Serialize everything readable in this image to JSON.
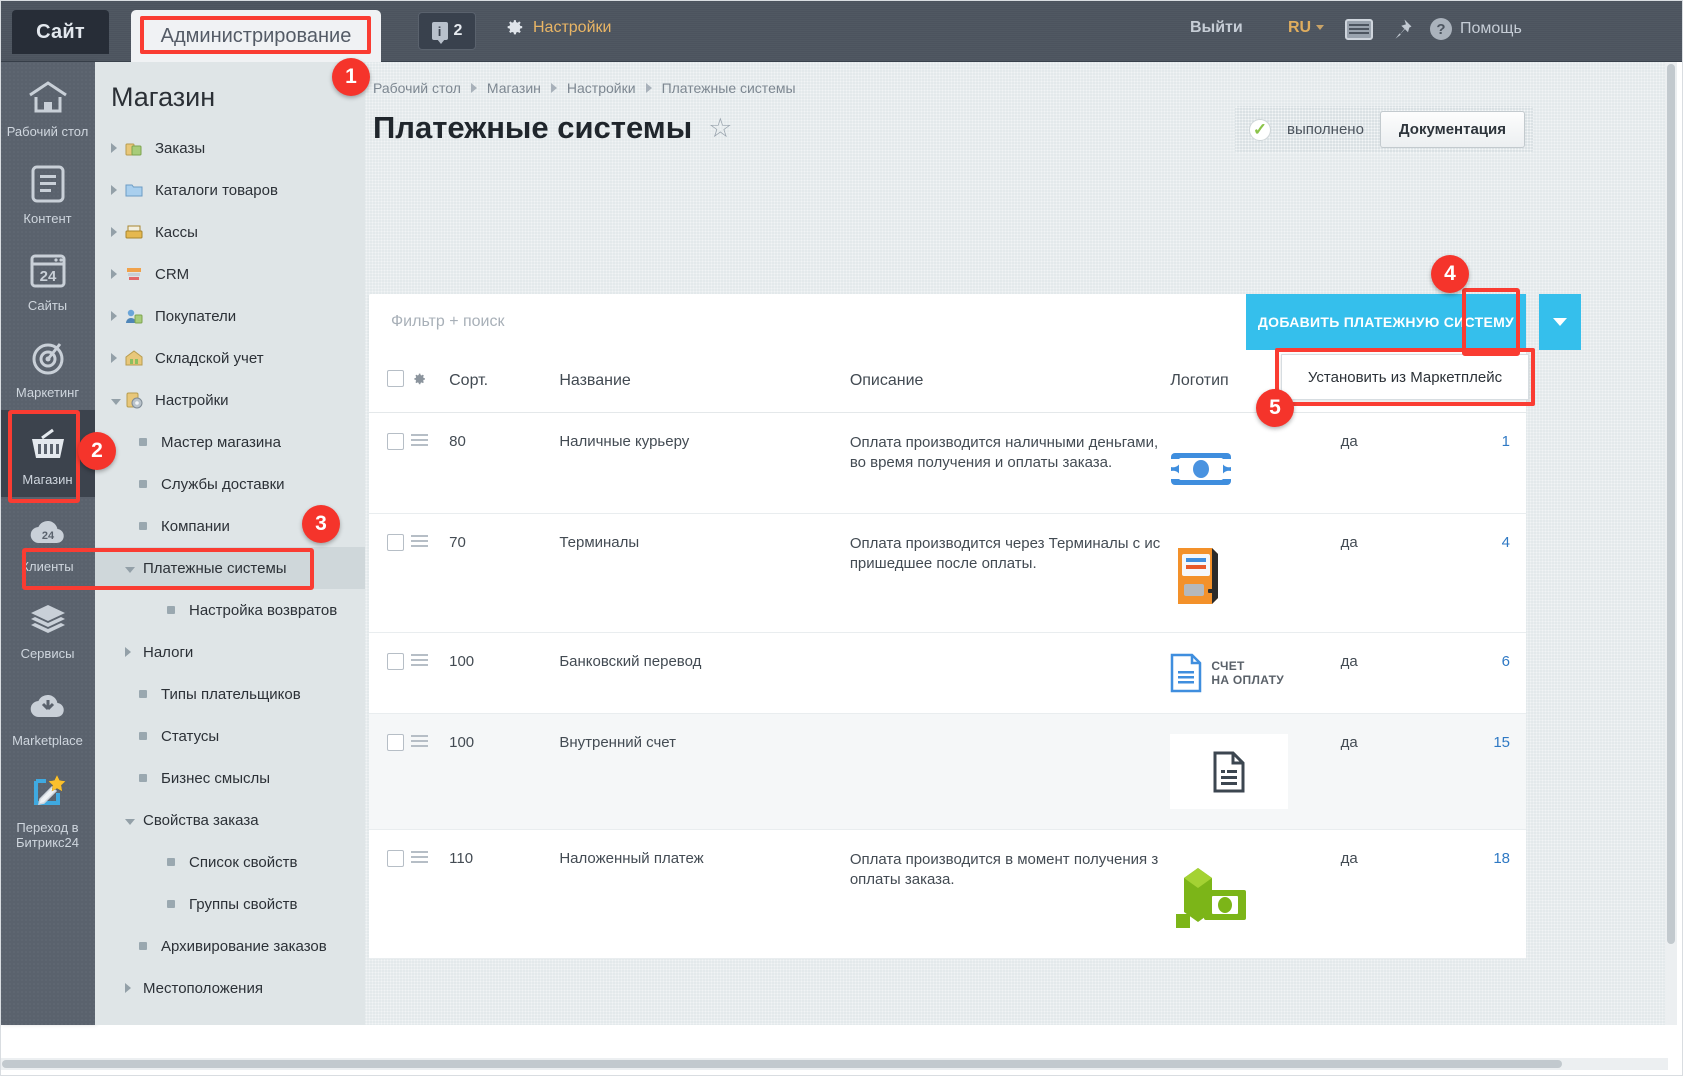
{
  "topbar": {
    "tab_site": "Сайт",
    "tab_admin": "Администрирование",
    "counter": "2",
    "settings": "Настройки",
    "logout": "Выйти",
    "language": "RU",
    "help": "Помощь",
    "icons": {
      "info": "info-icon",
      "gear": "gear-icon",
      "keyboard": "keyboard-icon",
      "pin": "pin-icon",
      "question": "question-icon"
    }
  },
  "rail": {
    "items": [
      {
        "label": "Рабочий стол",
        "icon": "home-icon",
        "active": false
      },
      {
        "label": "Контент",
        "icon": "document-icon",
        "active": false
      },
      {
        "label": "Сайты",
        "icon": "window24-icon",
        "active": false
      },
      {
        "label": "Маркетинг",
        "icon": "target-icon",
        "active": false
      },
      {
        "label": "Магазин",
        "icon": "basket-icon",
        "active": true
      },
      {
        "label": "Клиенты",
        "icon": "cloud24-icon",
        "active": false
      },
      {
        "label": "Сервисы",
        "icon": "layers-icon",
        "active": false
      },
      {
        "label": "Marketplace",
        "icon": "cloud-download-icon",
        "active": false
      },
      {
        "label": "Переход в Битрикс24",
        "icon": "switch-star-icon",
        "active": false
      }
    ]
  },
  "menu": {
    "title": "Магазин",
    "items": [
      {
        "label": "Заказы",
        "level": 1,
        "arrow": "right",
        "icon": "orders-icon",
        "selected": false
      },
      {
        "label": "Каталоги товаров",
        "level": 1,
        "arrow": "right",
        "icon": "folder-icon",
        "selected": false
      },
      {
        "label": "Кассы",
        "level": 1,
        "arrow": "right",
        "icon": "cashbox-icon",
        "selected": false
      },
      {
        "label": "CRM",
        "level": 1,
        "arrow": "right",
        "icon": "crm-icon",
        "selected": false
      },
      {
        "label": "Покупатели",
        "level": 1,
        "arrow": "right",
        "icon": "customers-icon",
        "selected": false
      },
      {
        "label": "Складской учет",
        "level": 1,
        "arrow": "right",
        "icon": "warehouse-icon",
        "selected": false
      },
      {
        "label": "Настройки",
        "level": 1,
        "arrow": "down",
        "icon": "settings-icon",
        "selected": false
      },
      {
        "label": "Мастер магазина",
        "level": 2,
        "arrow": "none",
        "icon": "bullet",
        "selected": false
      },
      {
        "label": "Службы доставки",
        "level": 2,
        "arrow": "none",
        "icon": "bullet",
        "selected": false
      },
      {
        "label": "Компании",
        "level": 2,
        "arrow": "none",
        "icon": "bullet",
        "selected": false
      },
      {
        "label": "Платежные системы",
        "level": 2,
        "arrow": "down",
        "icon": "none",
        "selected": true
      },
      {
        "label": "Настройка возвратов",
        "level": 3,
        "arrow": "none",
        "icon": "bullet",
        "selected": false
      },
      {
        "label": "Налоги",
        "level": 2,
        "arrow": "right",
        "icon": "none",
        "selected": false
      },
      {
        "label": "Типы плательщиков",
        "level": 2,
        "arrow": "none",
        "icon": "bullet",
        "selected": false
      },
      {
        "label": "Статусы",
        "level": 2,
        "arrow": "none",
        "icon": "bullet",
        "selected": false
      },
      {
        "label": "Бизнес смыслы",
        "level": 2,
        "arrow": "none",
        "icon": "bullet",
        "selected": false
      },
      {
        "label": "Свойства заказа",
        "level": 2,
        "arrow": "down",
        "icon": "none",
        "selected": false
      },
      {
        "label": "Список свойств",
        "level": 3,
        "arrow": "none",
        "icon": "bullet",
        "selected": false
      },
      {
        "label": "Группы свойств",
        "level": 3,
        "arrow": "none",
        "icon": "bullet",
        "selected": false
      },
      {
        "label": "Архивирование заказов",
        "level": 2,
        "arrow": "none",
        "icon": "bullet",
        "selected": false
      },
      {
        "label": "Местоположения",
        "level": 2,
        "arrow": "right",
        "icon": "none",
        "selected": false
      }
    ]
  },
  "content": {
    "breadcrumbs": [
      "Рабочий стол",
      "Магазин",
      "Настройки",
      "Платежные системы"
    ],
    "page_title": "Платежные системы",
    "favorite_icon": "star-icon",
    "status_text": "выполнено",
    "doc_button": "Документация",
    "toolbar": {
      "filter_placeholder": "Фильтр + поиск",
      "filter_value": "",
      "add_button": "ДОБАВИТЬ ПЛАТЕЖНУЮ СИСТЕМУ",
      "caret_icon": "chevron-down-icon",
      "dropdown_item": "Установить из Маркетплейс"
    },
    "table": {
      "headers": [
        "",
        "",
        "Сорт.",
        "Название",
        "Описание",
        "Логотип",
        "",
        ""
      ],
      "rows": [
        {
          "sort": "80",
          "name": "Наличные курьеру",
          "description": "Оплата производится наличными деньгами, во время получения и оплаты заказа.",
          "logo": "cash-icon",
          "active": "да",
          "id": "1"
        },
        {
          "sort": "70",
          "name": "Терминалы",
          "description": "Оплата производится через Терминалы с ис пришедшее после оплаты.",
          "logo": "terminal-icon",
          "active": "да",
          "id": "4"
        },
        {
          "sort": "100",
          "name": "Банковский перевод",
          "description": "",
          "logo": "invoice-icon",
          "logo_text_line1": "СЧЕТ",
          "logo_text_line2": "НА ОПЛАТУ",
          "active": "да",
          "id": "6"
        },
        {
          "sort": "100",
          "name": "Внутренний счет",
          "description": "",
          "logo": "document-dark-icon",
          "active": "да",
          "id": "15"
        },
        {
          "sort": "110",
          "name": "Наложенный платеж",
          "description": "Оплата производится в момент получения з оплаты заказа.",
          "logo": "cash-on-delivery-icon",
          "active": "да",
          "id": "18"
        }
      ]
    }
  },
  "annotations": [
    {
      "number": "1"
    },
    {
      "number": "2"
    },
    {
      "number": "3"
    },
    {
      "number": "4"
    },
    {
      "number": "5"
    }
  ],
  "colors": {
    "accent": "#35bfec",
    "highlight": "#fa3c32",
    "topbar": "#4d5560",
    "rail": "#5a626d",
    "menu": "#dfe5e7"
  }
}
